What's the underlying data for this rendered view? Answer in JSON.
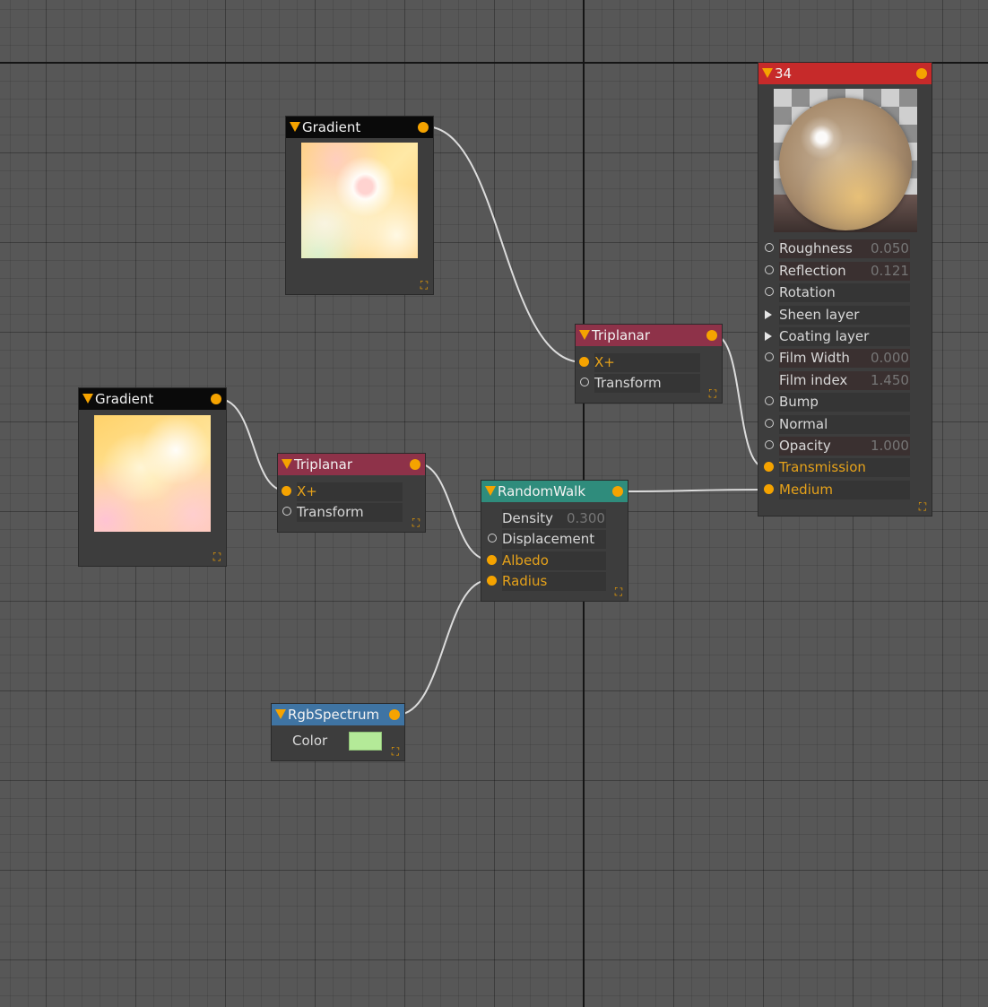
{
  "nodes": {
    "gradient_top": {
      "title": "Gradient"
    },
    "gradient_left": {
      "title": "Gradient"
    },
    "triplanar_top": {
      "title": "Triplanar",
      "inputs": [
        "X+",
        "Transform"
      ]
    },
    "triplanar_left": {
      "title": "Triplanar",
      "inputs": [
        "X+",
        "Transform"
      ]
    },
    "randomwalk": {
      "title": "RandomWalk",
      "density_label": "Density",
      "density_value": "0.300",
      "inputs": [
        "Displacement",
        "Albedo",
        "Radius"
      ]
    },
    "rgbspectrum": {
      "title": "RgbSpectrum",
      "color_label": "Color",
      "color": "#b4ea98"
    },
    "material": {
      "title": "34",
      "params": [
        {
          "label": "Roughness",
          "value": "0.050"
        },
        {
          "label": "Reflection",
          "value": "0.121"
        },
        {
          "label": "Rotation",
          "value": ""
        },
        {
          "label": "Sheen layer",
          "value": ""
        },
        {
          "label": "Coating layer",
          "value": ""
        },
        {
          "label": "Film Width",
          "value": "0.000"
        },
        {
          "label": "Film index",
          "value": "1.450"
        },
        {
          "label": "Bump",
          "value": ""
        },
        {
          "label": "Normal",
          "value": ""
        },
        {
          "label": "Opacity",
          "value": "1.000"
        },
        {
          "label": "Transmission",
          "value": ""
        },
        {
          "label": "Medium",
          "value": ""
        }
      ]
    }
  },
  "colors": {
    "accent": "#f5a300",
    "header_black": "#0a0a0a",
    "header_triplanar": "#8e3249",
    "header_randomwalk": "#2f8c7c",
    "header_rgbspectrum": "#3f74a3",
    "header_material": "#c62a2a"
  }
}
